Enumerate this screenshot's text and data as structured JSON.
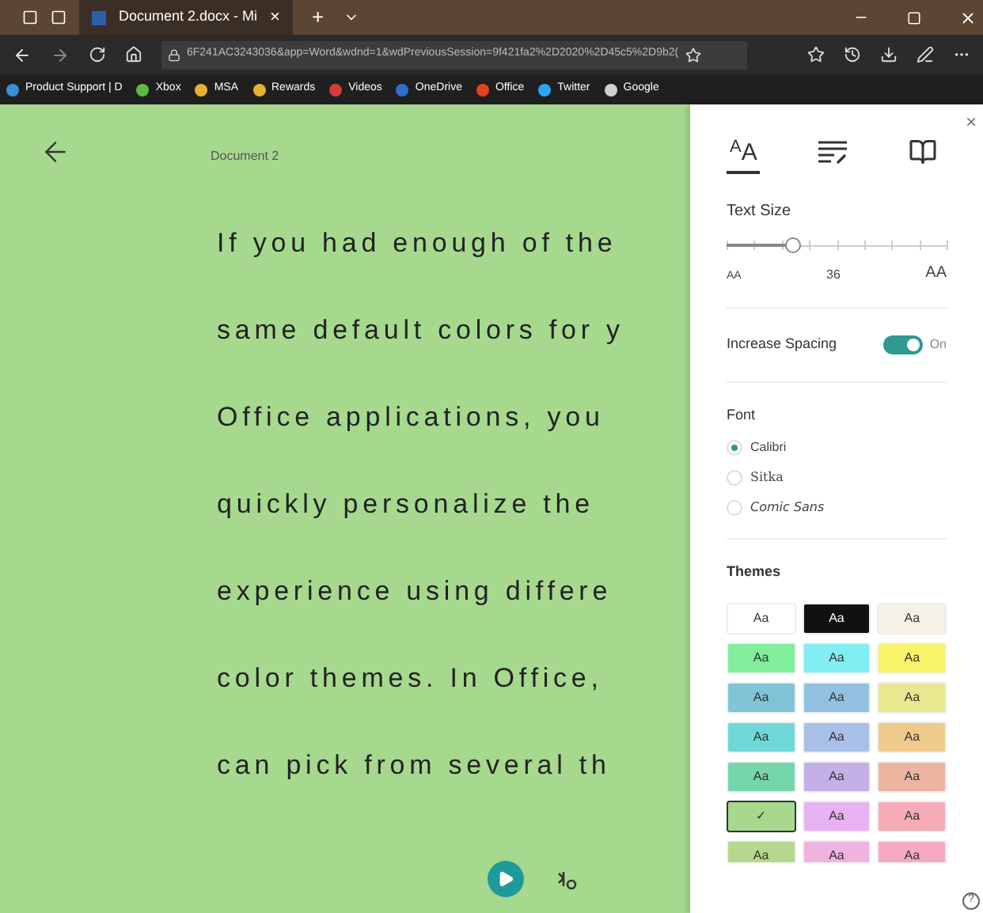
{
  "browser": {
    "tab_title": "Document 2.docx - Mi",
    "tab_close": "×",
    "new_tab": "+",
    "address": "6F241AC3243036&app=Word&wdnd=1&wdPreviousSession=9f421fa2%2D2020%2D45c5%2D9b2(",
    "bookmarks": [
      {
        "label": "Product Support | D",
        "color": "#3a8fd6"
      },
      {
        "label": "Xbox",
        "color": "#5db84a"
      },
      {
        "label": "MSA",
        "color": "#e8b030"
      },
      {
        "label": "Rewards",
        "color": "#e8b030"
      },
      {
        "label": "Videos",
        "color": "#d83b3b"
      },
      {
        "label": "OneDrive",
        "color": "#2f6fd0"
      },
      {
        "label": "Office",
        "color": "#e0451f"
      },
      {
        "label": "Twitter",
        "color": "#2ea3f2"
      },
      {
        "label": "Google",
        "color": "#d0d0d0"
      }
    ]
  },
  "document": {
    "title": "Document 2",
    "lines": [
      "If you had enough of the",
      "same default colors for y",
      "Office applications, you",
      "quickly personalize the",
      "experience using differe",
      "color themes. In Office,",
      "can pick from several th"
    ]
  },
  "panel": {
    "close": "×",
    "tabs": [
      {
        "kind": "text",
        "label": "AA",
        "selected": true
      },
      {
        "kind": "lines",
        "selected": false
      },
      {
        "kind": "book",
        "selected": false
      }
    ],
    "text_size": {
      "label": "Text Size",
      "level": 0.3,
      "min_label": "AA",
      "value": "36",
      "max_label": "AA"
    },
    "spacing": {
      "label": "Increase Spacing",
      "on": true,
      "state_label": "On"
    },
    "font": {
      "label": "Font",
      "options": [
        {
          "label": "Calibri",
          "kind": "sans",
          "selected": true
        },
        {
          "label": "Sitka",
          "kind": "serif",
          "selected": false
        },
        {
          "label": "Comic Sans",
          "kind": "comic",
          "selected": false
        }
      ]
    },
    "themes": {
      "label": "Themes",
      "items": [
        {
          "label": "Aa",
          "color": "#ffffff",
          "selected": false
        },
        {
          "label": "Aa",
          "color": "#111111",
          "selected": false
        },
        {
          "label": "Aa",
          "color": "#f5f1e6",
          "selected": false
        },
        {
          "label": "Aa",
          "color": "#80ee9a",
          "selected": false
        },
        {
          "label": "Aa",
          "color": "#82eef4",
          "selected": false
        },
        {
          "label": "Aa",
          "color": "#f8f46a",
          "selected": false
        },
        {
          "label": "Aa",
          "color": "#80c4d8",
          "selected": false
        },
        {
          "label": "Aa",
          "color": "#92c0e0",
          "selected": false
        },
        {
          "label": "Aa",
          "color": "#e8e890",
          "selected": false
        },
        {
          "label": "Aa",
          "color": "#70d8d8",
          "selected": false
        },
        {
          "label": "Aa",
          "color": "#a8c0e8",
          "selected": false
        },
        {
          "label": "Aa",
          "color": "#eecb8c",
          "selected": false
        },
        {
          "label": "Aa",
          "color": "#74d6aa",
          "selected": false
        },
        {
          "label": "Aa",
          "color": "#c4b0e8",
          "selected": false
        },
        {
          "label": "Aa",
          "color": "#eeb4a2",
          "selected": false
        },
        {
          "label": "✓",
          "color": "#a6d98e",
          "selected": true
        },
        {
          "label": "Aa",
          "color": "#e8b2f2",
          "selected": false
        },
        {
          "label": "Aa",
          "color": "#f5acb6",
          "selected": false
        },
        {
          "label": "Aa",
          "color": "#b6d88e",
          "selected": false
        },
        {
          "label": "Aa",
          "color": "#f0b2de",
          "selected": false
        },
        {
          "label": "Aa",
          "color": "#f4aac4",
          "selected": false
        }
      ]
    },
    "help": "?"
  }
}
